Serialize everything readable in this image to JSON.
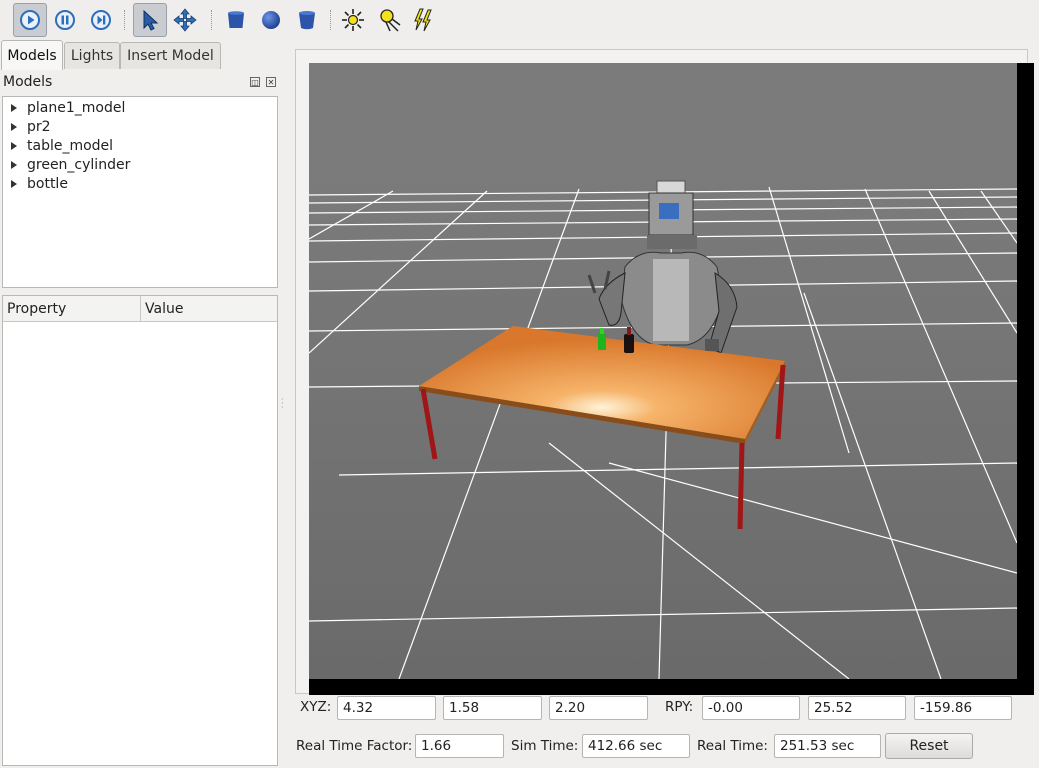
{
  "toolbar": {
    "buttons": [
      {
        "icon": "play-icon",
        "active": true
      },
      {
        "icon": "pause-icon"
      },
      {
        "icon": "step-icon"
      },
      {
        "icon": "select-arrow-icon",
        "active": true
      },
      {
        "icon": "translate-icon"
      },
      {
        "icon": "box-shape-icon"
      },
      {
        "icon": "sphere-shape-icon"
      },
      {
        "icon": "cylinder-shape-icon"
      },
      {
        "icon": "point-light-icon"
      },
      {
        "icon": "spot-light-icon"
      },
      {
        "icon": "directional-light-icon"
      }
    ]
  },
  "tabs": [
    {
      "label": "Models",
      "active": true
    },
    {
      "label": "Lights"
    },
    {
      "label": "Insert Model"
    }
  ],
  "models_panel": {
    "title": "Models",
    "items": [
      "plane1_model",
      "pr2",
      "table_model",
      "green_cylinder",
      "bottle"
    ]
  },
  "property_panel": {
    "columns": [
      "Property",
      "Value"
    ]
  },
  "pose": {
    "xyz_label": "XYZ:",
    "x": "4.32",
    "y": "1.58",
    "z": "2.20",
    "rpy_label": "RPY:",
    "roll": "-0.00",
    "pitch": "25.52",
    "yaw": "-159.86"
  },
  "stats": {
    "rtf_label": "Real Time Factor:",
    "rtf": "1.66",
    "sim_label": "Sim Time:",
    "sim": "412.66 sec",
    "real_label": "Real Time:",
    "real": "251.53 sec",
    "reset_label": "Reset"
  },
  "colors": {
    "sky": "#7a7a7a",
    "ground": "#6c6c6c",
    "grid": "#ffffff",
    "table_top": "#e8923c",
    "table_legs": "#a01515",
    "green_cylinder": "#1db51d",
    "bottle": "#1a1010"
  }
}
